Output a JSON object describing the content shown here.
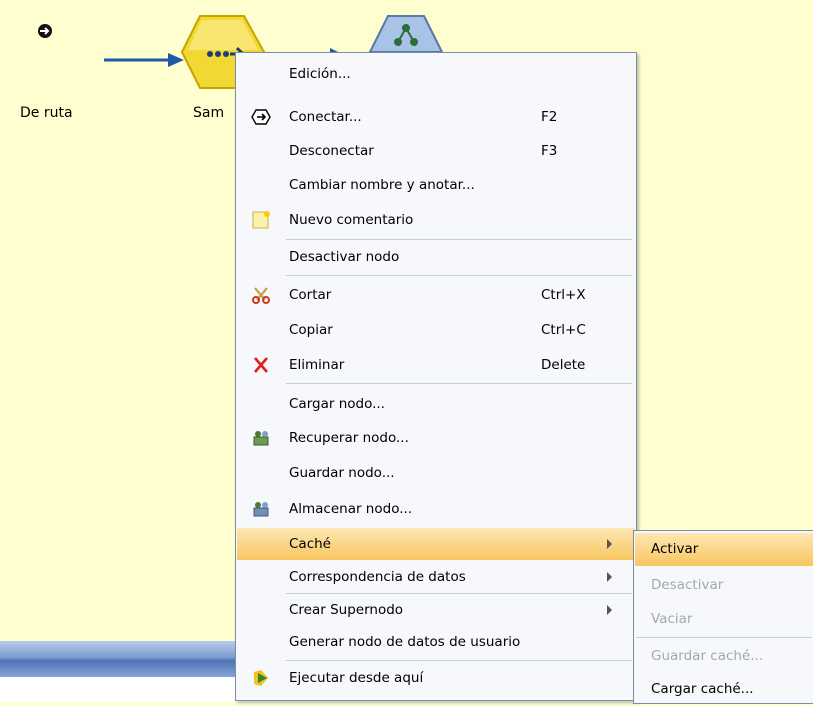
{
  "canvas": {
    "nodes": [
      {
        "label": "De ruta"
      },
      {
        "label": "Sam"
      }
    ]
  },
  "context_menu": {
    "items": [
      {
        "label": "Edición...",
        "shortcut": "",
        "icon": ""
      },
      {
        "label": "Conectar...",
        "shortcut": "F2",
        "icon": "connect-icon"
      },
      {
        "label": "Desconectar",
        "shortcut": "F3",
        "icon": ""
      },
      {
        "label": "Cambiar nombre y anotar...",
        "shortcut": "",
        "icon": ""
      },
      {
        "label": "Nuevo comentario",
        "shortcut": "",
        "icon": "comment-icon"
      },
      {
        "label": "Desactivar nodo",
        "shortcut": "",
        "icon": ""
      },
      {
        "label": "Cortar",
        "shortcut": "Ctrl+X",
        "icon": "scissors-icon"
      },
      {
        "label": "Copiar",
        "shortcut": "Ctrl+C",
        "icon": ""
      },
      {
        "label": "Eliminar",
        "shortcut": "Delete",
        "icon": "delete-icon"
      },
      {
        "label": "Cargar nodo...",
        "shortcut": "",
        "icon": ""
      },
      {
        "label": "Recuperar nodo...",
        "shortcut": "",
        "icon": "retrieve-node-icon"
      },
      {
        "label": "Guardar nodo...",
        "shortcut": "",
        "icon": ""
      },
      {
        "label": "Almacenar nodo...",
        "shortcut": "",
        "icon": "store-node-icon"
      },
      {
        "label": "Caché",
        "shortcut": "",
        "icon": "",
        "submenu": true,
        "highlighted": true
      },
      {
        "label": "Correspondencia de datos",
        "shortcut": "",
        "icon": "",
        "submenu": true
      },
      {
        "label": "Crear Supernodo",
        "shortcut": "",
        "icon": "",
        "submenu": true
      },
      {
        "label": "Generar nodo de datos de usuario",
        "shortcut": "",
        "icon": ""
      },
      {
        "label": "Ejecutar desde aquí",
        "shortcut": "",
        "icon": "run-icon"
      }
    ]
  },
  "cache_submenu": {
    "items": [
      {
        "label": "Activar",
        "enabled": true,
        "highlighted": true
      },
      {
        "label": "Desactivar",
        "enabled": false
      },
      {
        "label": "Vaciar",
        "enabled": false
      },
      {
        "label": "Guardar caché...",
        "enabled": false
      },
      {
        "label": "Cargar caché...",
        "enabled": true
      }
    ]
  },
  "colors": {
    "canvas_bg": "#fefecf",
    "menu_bg": "#f6f8fc",
    "highlight": "#f8c660",
    "flow_arrow": "#1f5aa6"
  }
}
